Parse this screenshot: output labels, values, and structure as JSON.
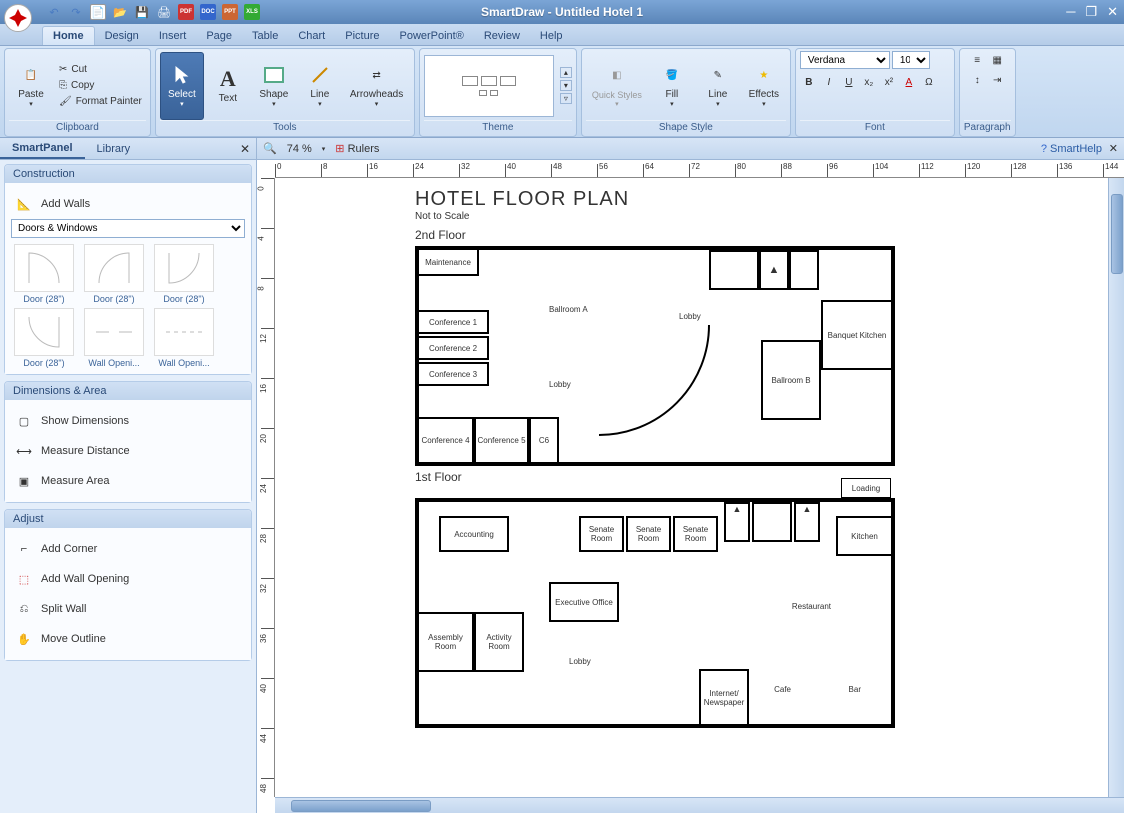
{
  "app_title": "SmartDraw - Untitled Hotel 1",
  "qat": [
    "undo",
    "redo",
    "new",
    "open",
    "save",
    "print",
    "pdf",
    "doc",
    "ppt",
    "xls"
  ],
  "menu": {
    "tabs": [
      "Home",
      "Design",
      "Insert",
      "Page",
      "Table",
      "Chart",
      "Picture",
      "PowerPoint®",
      "Review",
      "Help"
    ],
    "active": "Home"
  },
  "ribbon": {
    "clipboard": {
      "label": "Clipboard",
      "paste": "Paste",
      "cut": "Cut",
      "copy": "Copy",
      "formatpainter": "Format Painter"
    },
    "tools": {
      "label": "Tools",
      "select": "Select",
      "text": "Text",
      "shape": "Shape",
      "line": "Line",
      "arrowheads": "Arrowheads"
    },
    "theme": {
      "label": "Theme"
    },
    "shapestyle": {
      "label": "Shape Style",
      "quickstyles": "Quick Styles",
      "fill": "Fill",
      "line": "Line",
      "effects": "Effects"
    },
    "font": {
      "label": "Font",
      "family": "Verdana",
      "size": "10"
    },
    "paragraph": {
      "label": "Paragraph"
    }
  },
  "sidepanel": {
    "tabs": [
      "SmartPanel",
      "Library"
    ],
    "active": "SmartPanel",
    "construction": {
      "label": "Construction",
      "addwalls": "Add Walls",
      "dropdown": "Doors & Windows",
      "items": [
        "Door (28\")",
        "Door (28\")",
        "Door (28\")",
        "Door (28\")",
        "Wall Openi...",
        "Wall Openi..."
      ]
    },
    "dimensions": {
      "label": "Dimensions & Area",
      "show": "Show Dimensions",
      "measure": "Measure Distance",
      "area": "Measure Area"
    },
    "adjust": {
      "label": "Adjust",
      "corner": "Add Corner",
      "opening": "Add Wall Opening",
      "split": "Split Wall",
      "outline": "Move Outline"
    }
  },
  "canvas": {
    "zoom": "74 %",
    "rulers": "Rulers",
    "smarthelp": "SmartHelp",
    "ruler_h": [
      "0",
      "8",
      "16",
      "24",
      "32",
      "40",
      "48",
      "56",
      "64",
      "72",
      "80",
      "88",
      "96",
      "104",
      "112",
      "120",
      "128",
      "136",
      "144"
    ],
    "ruler_v": [
      "0",
      "4",
      "8",
      "12",
      "16",
      "20",
      "24",
      "28",
      "32",
      "36",
      "40",
      "44",
      "48"
    ]
  },
  "plan": {
    "title": "HOTEL FLOOR PLAN",
    "sub": "Not to Scale",
    "floor2": {
      "label": "2nd Floor",
      "rooms": [
        "Maintenance",
        "Ballroom A",
        "Lobby",
        "Banquet Kitchen",
        "Conference 1",
        "Conference 2",
        "Conference 3",
        "Lobby",
        "Ballroom B",
        "Conference 4",
        "Conference 5",
        "C6"
      ]
    },
    "floor1": {
      "label": "1st Floor",
      "loading": "Loading",
      "rooms": [
        "Accounting",
        "Senate Room",
        "Senate Room",
        "Senate Room",
        "Kitchen",
        "Executive Office",
        "Restaurant",
        "Assembly Room",
        "Activity Room",
        "Lobby",
        "Internet/ Newspaper",
        "Cafe",
        "Bar"
      ]
    }
  }
}
